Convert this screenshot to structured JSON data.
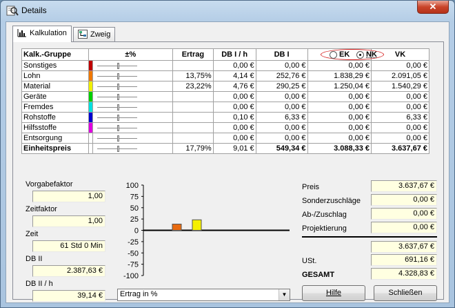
{
  "window": {
    "title": "Details",
    "close_label": "✕"
  },
  "tabs": [
    {
      "label": "Kalkulation"
    },
    {
      "label": "Zweig"
    }
  ],
  "table": {
    "headers": {
      "group": "Kalk.-Gruppe",
      "pct": "±%",
      "ertrag": "Ertrag",
      "dbh": "DB I / h",
      "db": "DB I",
      "vk": "VK"
    },
    "rows": [
      {
        "name": "Sonstiges",
        "color": "#c00000",
        "ertrag": "",
        "dbh": "0,00 €",
        "db": "0,00 €",
        "ek": "0,00 €",
        "vk": "0,00 €"
      },
      {
        "name": "Lohn",
        "color": "#f07800",
        "ertrag": "13,75%",
        "dbh": "4,14 €",
        "db": "252,76 €",
        "ek": "1.838,29 €",
        "vk": "2.091,05 €"
      },
      {
        "name": "Material",
        "color": "#f0f000",
        "ertrag": "23,22%",
        "dbh": "4,76 €",
        "db": "290,25 €",
        "ek": "1.250,04 €",
        "vk": "1.540,29 €"
      },
      {
        "name": "Geräte",
        "color": "#00d000",
        "ertrag": "",
        "dbh": "0,00 €",
        "db": "0,00 €",
        "ek": "0,00 €",
        "vk": "0,00 €"
      },
      {
        "name": "Fremdes",
        "color": "#00e0e0",
        "ertrag": "",
        "dbh": "0,00 €",
        "db": "0,00 €",
        "ek": "0,00 €",
        "vk": "0,00 €"
      },
      {
        "name": "Rohstoffe",
        "color": "#0000d0",
        "ertrag": "",
        "dbh": "0,10 €",
        "db": "6,33 €",
        "ek": "0,00 €",
        "vk": "6,33 €"
      },
      {
        "name": "Hilfsstoffe",
        "color": "#e000e0",
        "ertrag": "",
        "dbh": "0,00 €",
        "db": "0,00 €",
        "ek": "0,00 €",
        "vk": "0,00 €"
      },
      {
        "name": "Entsorgung",
        "color": "#ffffff",
        "ertrag": "",
        "dbh": "0,00 €",
        "db": "0,00 €",
        "ek": "0,00 €",
        "vk": "0,00 €"
      }
    ],
    "total": {
      "name": "Einheitspreis",
      "ertrag": "17,79%",
      "dbh": "9,01 €",
      "db": "549,34 €",
      "ek": "3.088,33 €",
      "vk": "3.637,67 €"
    },
    "ek_label": "EK",
    "nk_label": "NK",
    "selected": "NK"
  },
  "left": {
    "vorgabefaktor_label": "Vorgabefaktor",
    "vorgabefaktor": "1,00",
    "zeitfaktor_label": "Zeitfaktor",
    "zeitfaktor": "1,00",
    "zeit_label": "Zeit",
    "zeit": "61 Std 0 Min",
    "db2_label": "DB II",
    "db2": "2.387,63 €",
    "db2h_label": "DB II / h",
    "db2h": "39,14 €"
  },
  "chart_data": {
    "type": "bar",
    "categories": [
      "Lohn",
      "Material"
    ],
    "values": [
      13.75,
      23.22
    ],
    "colors": [
      "#e86a10",
      "#f5f000"
    ],
    "ylim": [
      -100,
      100
    ],
    "yticks": [
      "100",
      "75",
      "50",
      "25",
      "0",
      "-25",
      "-50",
      "-75",
      "-100"
    ],
    "title": "",
    "xlabel": "",
    "ylabel": ""
  },
  "chart_selector": {
    "value": "Ertrag in %"
  },
  "right": {
    "preis_label": "Preis",
    "preis": "3.637,67 €",
    "sonder_label": "Sonderzuschläge",
    "sonder": "0,00 €",
    "ab_label": "Ab-/Zuschlag",
    "ab": "0,00 €",
    "proj_label": "Projektierung",
    "proj": "0,00 €",
    "subtotal": "3.637,67 €",
    "ust_label": "USt.",
    "ust": "691,16 €",
    "gesamt_label": "GESAMT",
    "gesamt": "4.328,83 €"
  },
  "buttons": {
    "hilfe": "Hilfe",
    "schliessen": "Schließen"
  }
}
